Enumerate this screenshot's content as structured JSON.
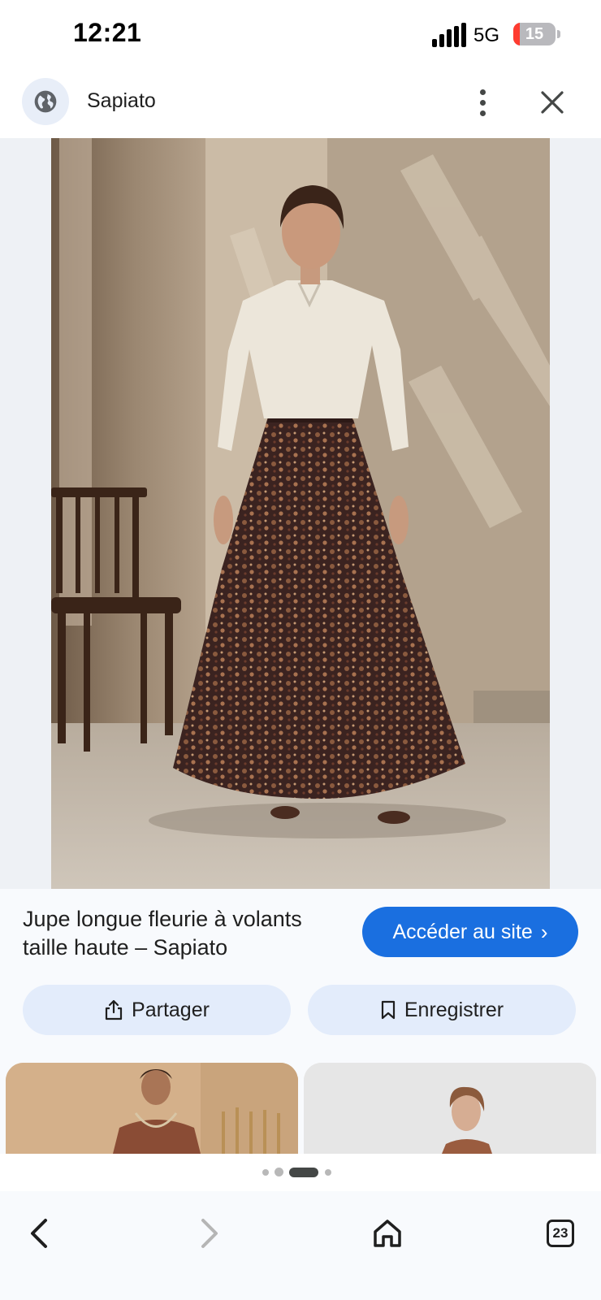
{
  "status_bar": {
    "time": "12:21",
    "network": "5G",
    "battery_level": "15",
    "battery_fraction": 0.15
  },
  "header": {
    "site_name": "Sapiato",
    "site_icon": "globe-icon"
  },
  "main_image": {
    "description_icon": "product-photo"
  },
  "info": {
    "title": "Jupe longue fleurie à volants taille haute – Sapiato",
    "visit_button": "Accéder au site",
    "share_button": "Partager",
    "save_button": "Enregistrer"
  },
  "pager": {
    "pages": 4,
    "active_index": 2
  },
  "bottom_nav": {
    "tab_count": "23"
  },
  "colors": {
    "accent": "#1a6fe0",
    "chip_bg": "#e3ecfb",
    "battery_low": "#ff3b30"
  }
}
